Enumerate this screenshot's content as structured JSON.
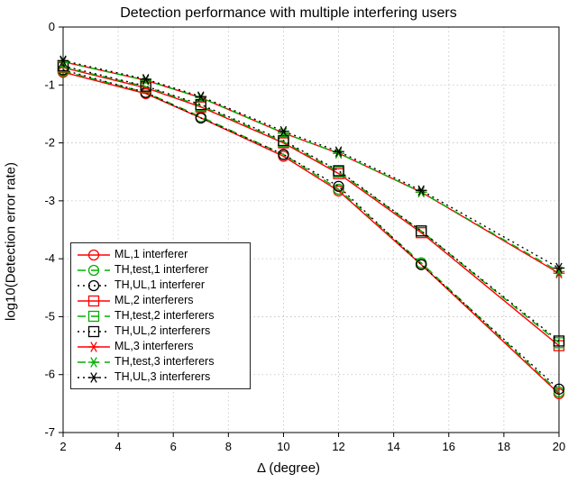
{
  "chart_data": {
    "type": "line",
    "title": "Detection performance with multiple interfering users",
    "xlabel": "Δ (degree)",
    "ylabel": "log10(Detection error rate)",
    "xlim": [
      2,
      20
    ],
    "ylim": [
      -7,
      0
    ],
    "xticks": [
      2,
      4,
      6,
      8,
      10,
      12,
      14,
      16,
      18,
      20
    ],
    "yticks": [
      -7,
      -6,
      -5,
      -4,
      -3,
      -2,
      -1,
      0
    ],
    "x": [
      2,
      5,
      7,
      10,
      12,
      15,
      20
    ],
    "series": [
      {
        "name": "ML,1 interferer",
        "color": "#ff0000",
        "dash": "solid",
        "marker": "circle",
        "values": [
          -0.78,
          -1.15,
          -1.57,
          -2.23,
          -2.83,
          -4.1,
          -6.33
        ]
      },
      {
        "name": "TH,test,1 interferer",
        "color": "#00b100",
        "dash": "dash",
        "marker": "circle",
        "values": [
          -0.76,
          -1.13,
          -1.55,
          -2.2,
          -2.8,
          -4.07,
          -6.3
        ]
      },
      {
        "name": "TH,UL,1 interferer",
        "color": "#000000",
        "dash": "dot",
        "marker": "circle",
        "values": [
          -0.74,
          -1.13,
          -1.57,
          -2.2,
          -2.75,
          -4.1,
          -6.25
        ]
      },
      {
        "name": "ML,2 interferers",
        "color": "#ff0000",
        "dash": "solid",
        "marker": "square",
        "values": [
          -0.7,
          -1.05,
          -1.38,
          -2.0,
          -2.53,
          -3.55,
          -5.5
        ]
      },
      {
        "name": "TH,test,2 interferers",
        "color": "#00b100",
        "dash": "dash",
        "marker": "square",
        "values": [
          -0.69,
          -1.03,
          -1.36,
          -1.98,
          -2.5,
          -3.52,
          -5.45
        ]
      },
      {
        "name": "TH,UL,2 interferers",
        "color": "#000000",
        "dash": "dot",
        "marker": "square",
        "values": [
          -0.67,
          -1.02,
          -1.34,
          -1.96,
          -2.48,
          -3.52,
          -5.42
        ]
      },
      {
        "name": "ML,3 interferers",
        "color": "#ff0000",
        "dash": "solid",
        "marker": "asterisk",
        "values": [
          -0.6,
          -0.92,
          -1.22,
          -1.83,
          -2.18,
          -2.85,
          -4.25
        ]
      },
      {
        "name": "TH,test,3 interferers",
        "color": "#00b100",
        "dash": "dash",
        "marker": "asterisk",
        "values": [
          -0.6,
          -0.92,
          -1.22,
          -1.83,
          -2.18,
          -2.85,
          -4.22
        ]
      },
      {
        "name": "TH,UL,3 interferers",
        "color": "#000000",
        "dash": "dot",
        "marker": "asterisk",
        "values": [
          -0.58,
          -0.9,
          -1.2,
          -1.8,
          -2.15,
          -2.82,
          -4.16
        ]
      }
    ]
  }
}
